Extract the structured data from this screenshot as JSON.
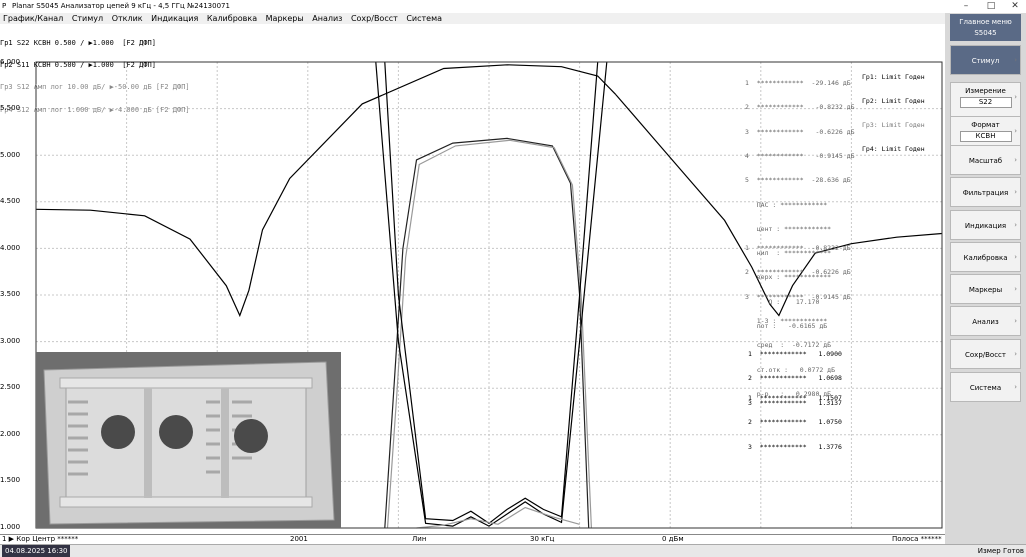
{
  "window": {
    "app_icon": "P",
    "title": "Planar  S5045   Анализатор цепей   9 кГц - 4,5 ГГц   №24130071",
    "controls": [
      "–",
      "□",
      "✕"
    ]
  },
  "menu": [
    "График/Канал",
    "Стимул",
    "Отклик",
    "Индикация",
    "Калибровка",
    "Маркеры",
    "Анализ",
    "Сохр/Восст",
    "Система"
  ],
  "traces": [
    "Гр1 S22 КСВН 0.500 / ▶1.000  [F2 ДФП]",
    "Гр2 S11 КСВН 0.500 / ▶1.000  [F2 ДФП]",
    "Гр3 S12 Амп лог 10.00 дБ/ ▶-50.00 дБ [F2 ДФП]",
    "Гр4 S12 Амп лог 1.000 дБ/ ▶-4.000 дБ [F2 ДФП]"
  ],
  "y_axis": [
    "6.000",
    "5.500",
    "5.000",
    "4.500",
    "4.000",
    "3.500",
    "3.000",
    "2.500",
    "2.000",
    "1.500",
    "1.000"
  ],
  "chart_data": {
    "type": "line",
    "ylim": [
      1.0,
      6.0
    ],
    "xlim": [
      0,
      100
    ],
    "grid": true,
    "series": [
      {
        "x": [
          0,
          6,
          12,
          17,
          21,
          22.5,
          23.5,
          25,
          28,
          36,
          45,
          52,
          58,
          62,
          64
        ],
        "y": [
          4.42,
          4.41,
          4.35,
          4.1,
          3.6,
          3.28,
          3.55,
          4.2,
          4.75,
          5.55,
          5.93,
          5.97,
          5.95,
          5.85,
          5.65
        ],
        "color": "#000"
      },
      {
        "x": [
          64,
          68,
          72,
          76,
          79,
          81,
          82,
          83.5,
          86,
          90,
          95,
          100
        ],
        "y": [
          5.65,
          5.2,
          4.75,
          4.3,
          3.8,
          3.4,
          3.28,
          3.6,
          3.95,
          4.05,
          4.12,
          4.16
        ],
        "color": "#000"
      },
      {
        "x": [
          38.5,
          39.5,
          40.5,
          42,
          46,
          52,
          57,
          59,
          60,
          61
        ],
        "y": [
          1.0,
          2.5,
          4.0,
          4.95,
          5.13,
          5.18,
          5.1,
          4.7,
          3.5,
          1.0
        ],
        "color": "#222"
      },
      {
        "x": [
          38.8,
          39.8,
          40.8,
          42.3,
          46.3,
          52.3,
          57.2,
          59.2,
          60.2,
          61.3
        ],
        "y": [
          1.0,
          2.4,
          3.9,
          4.9,
          5.1,
          5.16,
          5.08,
          4.68,
          3.45,
          1.0
        ],
        "color": "#999"
      },
      {
        "x": [
          38.5,
          40,
          43,
          46,
          48,
          50,
          52,
          54,
          56,
          58,
          60,
          62
        ],
        "y": [
          6.0,
          3.5,
          1.1,
          1.08,
          1.18,
          1.05,
          1.2,
          1.32,
          1.2,
          1.12,
          3.5,
          6.0
        ],
        "color": "#000"
      },
      {
        "x": [
          37.5,
          40,
          43,
          46,
          48,
          50,
          52,
          54,
          56,
          58,
          60,
          63
        ],
        "y": [
          6.0,
          3.0,
          1.05,
          1.02,
          1.12,
          1.02,
          1.15,
          1.28,
          1.15,
          1.06,
          3.0,
          6.0
        ],
        "color": "#000"
      },
      {
        "x": [
          42,
          45,
          48,
          51,
          54,
          57,
          60
        ],
        "y": [
          1.0,
          1.03,
          1.1,
          1.04,
          1.22,
          1.12,
          1.04
        ],
        "color": "#999"
      }
    ]
  },
  "markers_top": [
    "1  ************  -29.146 дБ",
    "2  ************   -0.8232 дБ",
    "3  ************   -0.6226 дБ",
    "4  ************   -0.9145 дБ",
    "5  ************  -28.636 дБ",
    "   ПАС : ************",
    "   цент : ************",
    "   нил  : ************",
    "   верх : ************",
    "      Q :    17.170",
    "   пот :   -0.6165 дБ"
  ],
  "limits": [
    "Гр1: Limit Годен",
    "Гр2: Limit Годен",
    "Гр3: Limit Годен",
    "Гр4: Limit Годен"
  ],
  "markers_mid": [
    "1  ************  -0.8232 дБ",
    "2  ************  -0.6226 дБ",
    "3  ************  -0.9145 дБ",
    "   1-3 : ************",
    "   сред  :  -0.7172 дБ",
    "   ст.отк :   0.0772 дБ",
    "   р-р   :   0.2980 дБ"
  ],
  "markers_s22": [
    "1  ************   1.0900",
    "2  ************   1.0698",
    "3  ************   1.3137"
  ],
  "markers_s11": [
    "1  ************   1.1507",
    "2  ************   1.0750",
    "3  ************   1.3776"
  ],
  "bottom": {
    "left": "1 ▶ Кор  Центр ******",
    "pts": "2001",
    "type": "Лин",
    "ifbw": "30 кГц",
    "power": "0 дБм",
    "right": "Полоса ******"
  },
  "status": {
    "date": "04.08.2025 16:30",
    "right": "Измер   Готов"
  },
  "softkeys": {
    "header_line1": "Главное меню",
    "header_line2": "S5045",
    "items": [
      {
        "label": "Стимул",
        "active": true
      },
      {
        "label": "Измерение",
        "value": "S22"
      },
      {
        "label": "Формат",
        "value": "КСВН"
      },
      {
        "label": "Масштаб"
      },
      {
        "label": "Фильтрация"
      },
      {
        "label": "Индикация"
      },
      {
        "label": "Калибровка"
      },
      {
        "label": "Маркеры"
      },
      {
        "label": "Анализ"
      },
      {
        "label": "Сохр/Восст"
      },
      {
        "label": "Система"
      }
    ]
  }
}
